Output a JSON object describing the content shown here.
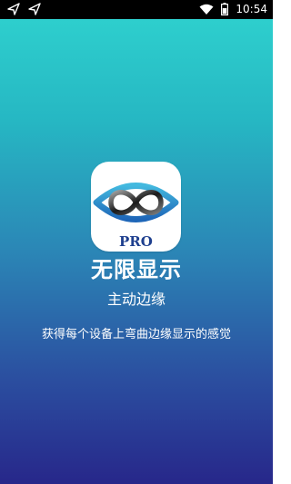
{
  "status_bar": {
    "time": "10:54",
    "left_icons": [
      "send-icon",
      "send-icon"
    ],
    "right_icons": [
      "wifi-icon",
      "battery-icon"
    ]
  },
  "splash": {
    "app_icon_name": "infinity-eye-icon",
    "badge_text": "PRO",
    "title": "无限显示",
    "subtitle": "主动边缘",
    "tagline": "获得每个设备上弯曲边缘显示的感觉"
  },
  "colors": {
    "gradient_top": "#2fd3cf",
    "gradient_bottom": "#27278a",
    "badge": "#1e3f8e",
    "text": "#ffffff"
  }
}
